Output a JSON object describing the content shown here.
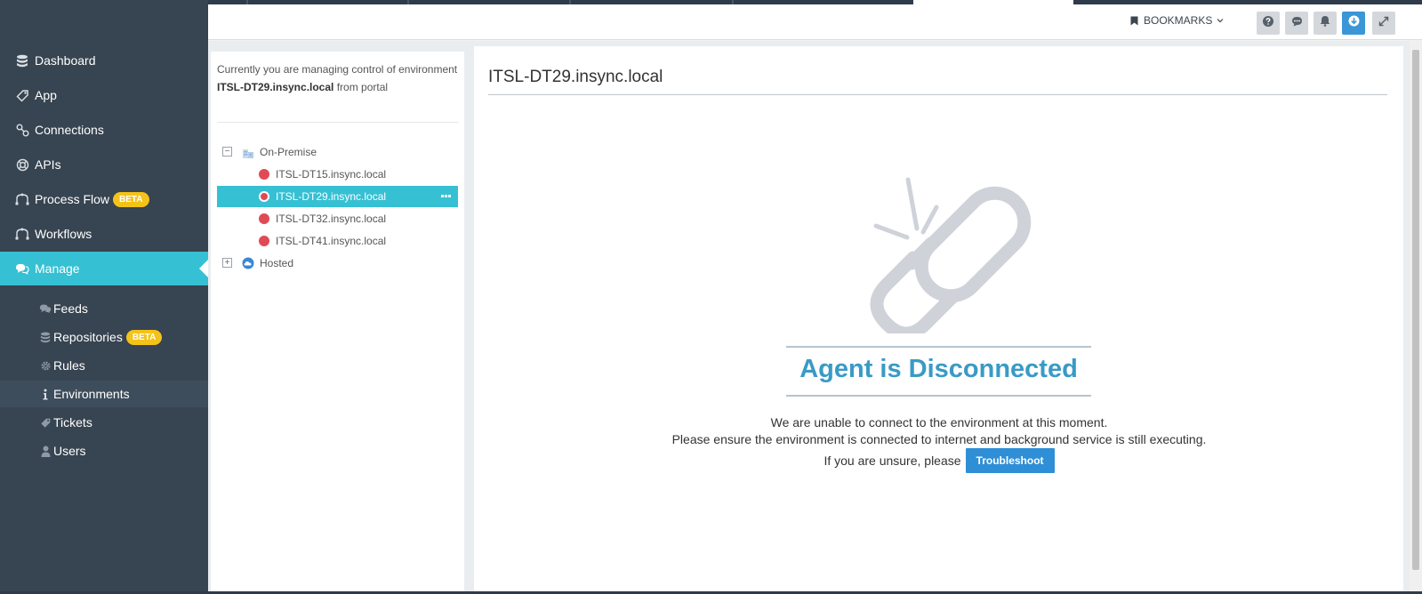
{
  "sidebar": {
    "nav": [
      {
        "label": "Dashboard",
        "icon": "database-icon"
      },
      {
        "label": "App",
        "icon": "tag-icon"
      },
      {
        "label": "Connections",
        "icon": "link-icon"
      },
      {
        "label": "APIs",
        "icon": "lifebuoy-icon"
      },
      {
        "label": "Process Flow",
        "icon": "flow-icon",
        "badge": "BETA"
      },
      {
        "label": "Workflows",
        "icon": "flow-icon"
      },
      {
        "label": "Manage",
        "icon": "comments-icon",
        "active": true
      }
    ],
    "sub": [
      {
        "label": "Feeds",
        "icon": "comments-icon"
      },
      {
        "label": "Repositories",
        "icon": "database-icon",
        "badge": "BETA"
      },
      {
        "label": "Rules",
        "icon": "gear-icon"
      },
      {
        "label": "Environments",
        "icon": "info-icon",
        "selected": true
      },
      {
        "label": "Tickets",
        "icon": "tag-icon"
      },
      {
        "label": "Users",
        "icon": "user-icon"
      }
    ]
  },
  "header": {
    "bookmarks_label": "BOOKMARKS",
    "buttons": [
      "help-icon",
      "chat-icon",
      "bell-icon",
      "download-icon",
      "expand-icon"
    ]
  },
  "tree": {
    "intro_prefix": "Currently you are managing control of environment",
    "intro_env": "ITSL-DT29.insync.local",
    "intro_suffix": "from portal",
    "groups": [
      {
        "label": "On-Premise",
        "expanded": true,
        "toggle": "−",
        "items": [
          "ITSL-DT15.insync.local",
          "ITSL-DT29.insync.local",
          "ITSL-DT32.insync.local",
          "ITSL-DT41.insync.local"
        ],
        "selected_item": "ITSL-DT29.insync.local"
      },
      {
        "label": "Hosted",
        "expanded": false,
        "toggle": "+"
      }
    ]
  },
  "main": {
    "title": "ITSL-DT29.insync.local",
    "status_title": "Agent is Disconnected",
    "message_line1": "We are unable to connect to the environment at this moment.",
    "message_line2": "Please ensure the environment is connected to internet and background service is still executing.",
    "unsure_text": "If you are unsure, please",
    "troubleshoot_label": "Troubleshoot"
  },
  "colors": {
    "sidebar_bg": "#374451",
    "accent": "#36c0d3",
    "badge": "#f4c319",
    "status_dot": "#e04a55",
    "title_blue": "#3a9ac6",
    "button_blue": "#2f8fd6"
  }
}
